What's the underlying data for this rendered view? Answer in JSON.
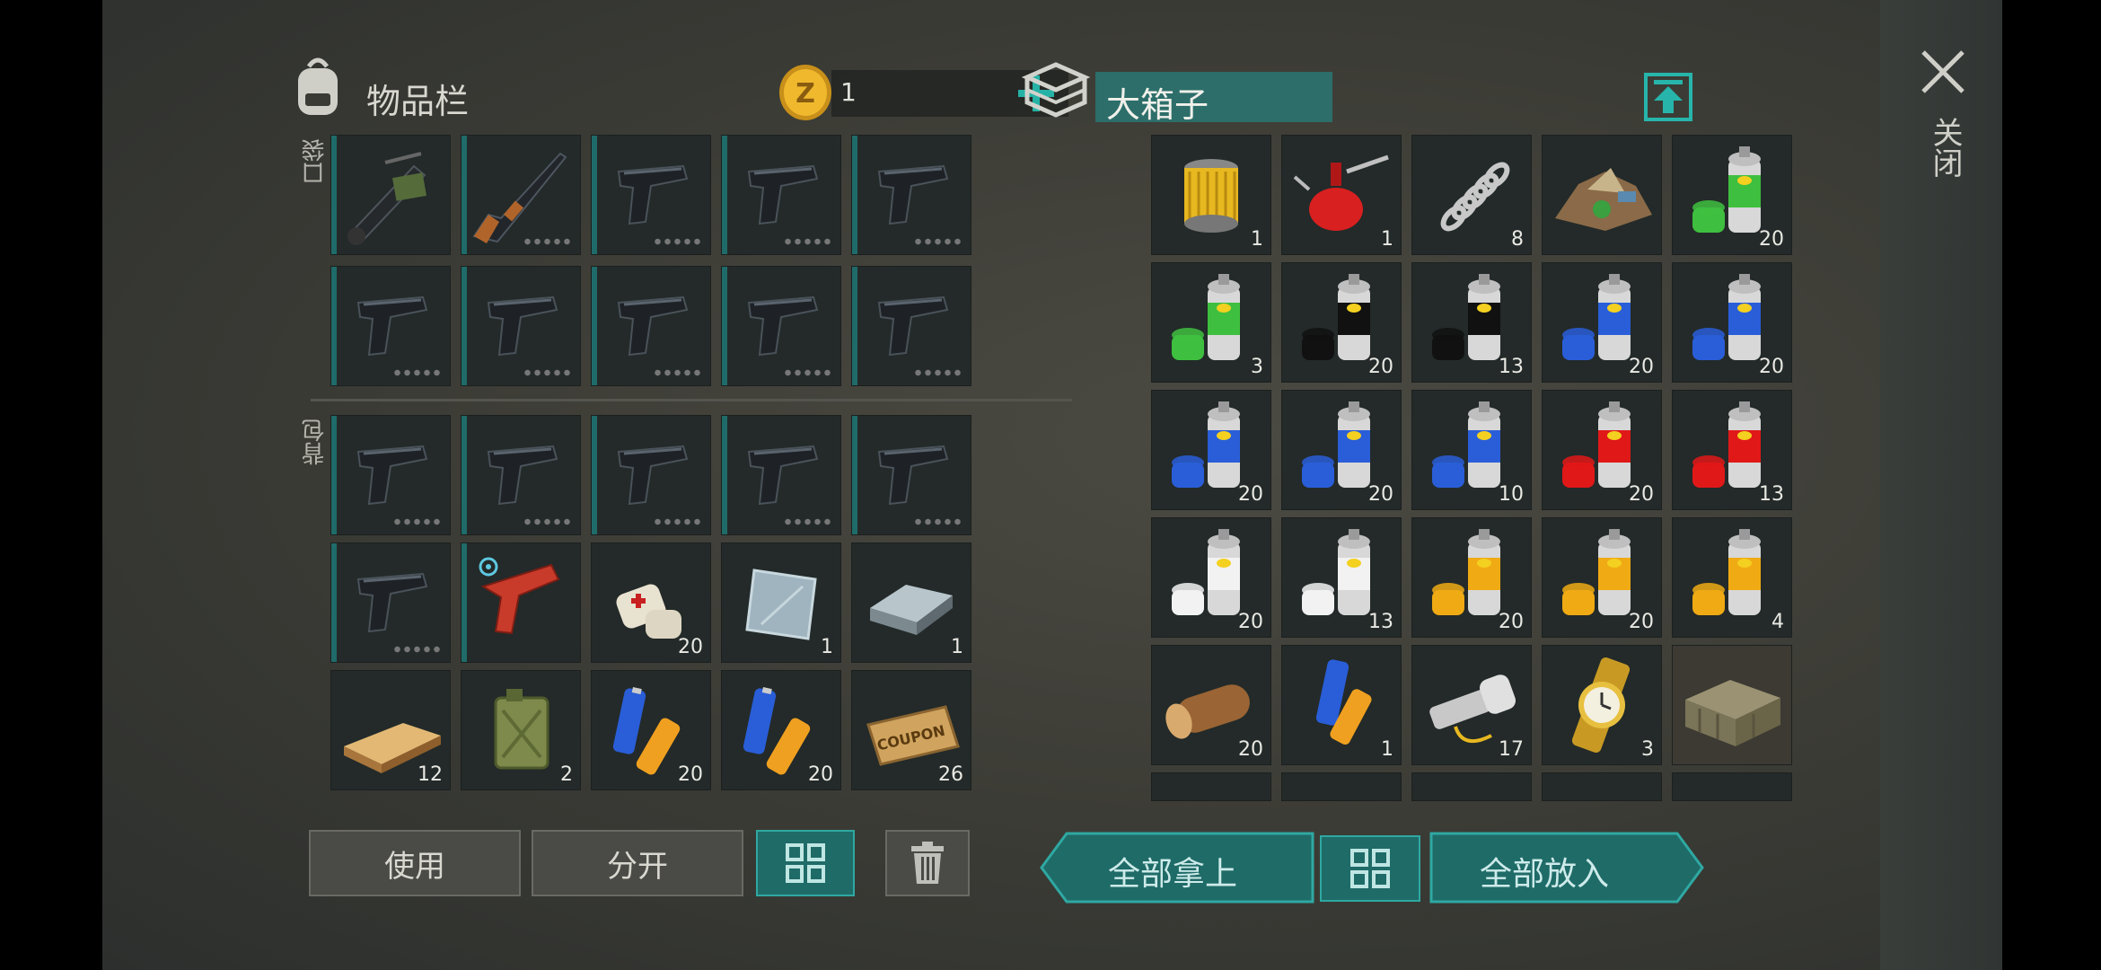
{
  "inventory": {
    "title": "物品栏",
    "currency_value": "1",
    "pocket_label": "口袋",
    "backpack_label": "背包",
    "pocket_items": [
      {
        "icon": "grenade-launcher-icon",
        "count": "",
        "weapon": true
      },
      {
        "icon": "rifle-icon",
        "count": "",
        "weapon": true,
        "dots": true
      },
      {
        "icon": "pistol-icon",
        "count": "",
        "weapon": true,
        "dots": true
      },
      {
        "icon": "pistol-icon",
        "count": "",
        "weapon": true,
        "dots": true
      },
      {
        "icon": "pistol-icon",
        "count": "",
        "weapon": true,
        "dots": true
      },
      {
        "icon": "pistol-icon",
        "count": "",
        "weapon": true,
        "dots": true
      },
      {
        "icon": "pistol-icon",
        "count": "",
        "weapon": true,
        "dots": true
      },
      {
        "icon": "pistol-icon",
        "count": "",
        "weapon": true,
        "dots": true
      },
      {
        "icon": "pistol-icon",
        "count": "",
        "weapon": true,
        "dots": true
      },
      {
        "icon": "pistol-icon",
        "count": "",
        "weapon": true,
        "dots": true
      }
    ],
    "backpack_items": [
      {
        "icon": "pistol-icon",
        "count": "",
        "weapon": true,
        "dots": true
      },
      {
        "icon": "pistol-icon",
        "count": "",
        "weapon": true,
        "dots": true
      },
      {
        "icon": "pistol-icon",
        "count": "",
        "weapon": true,
        "dots": true
      },
      {
        "icon": "pistol-icon",
        "count": "",
        "weapon": true,
        "dots": true
      },
      {
        "icon": "pistol-icon",
        "count": "",
        "weapon": true,
        "dots": true
      },
      {
        "icon": "pistol-icon",
        "count": "",
        "weapon": true,
        "dots": true
      },
      {
        "icon": "flare-gun-icon",
        "count": "",
        "weapon": true
      },
      {
        "icon": "bandage-icon",
        "count": "20"
      },
      {
        "icon": "metal-plate-icon",
        "count": "1"
      },
      {
        "icon": "steel-ingot-icon",
        "count": "1"
      },
      {
        "icon": "wood-plank-icon",
        "count": "12"
      },
      {
        "icon": "jerrycan-icon",
        "count": "2"
      },
      {
        "icon": "batteries-icon",
        "count": "20"
      },
      {
        "icon": "batteries-icon",
        "count": "20"
      },
      {
        "icon": "coupon-icon",
        "count": "26"
      }
    ],
    "buttons": {
      "use": "使用",
      "split": "分开"
    }
  },
  "container": {
    "title": "大箱子",
    "items": [
      {
        "icon": "oil-filter-icon",
        "count": "1"
      },
      {
        "icon": "oil-can-icon",
        "count": "1"
      },
      {
        "icon": "spring-icon",
        "count": "8"
      },
      {
        "icon": "scrap-pile-icon",
        "count": ""
      },
      {
        "icon": "spray-paint-icon",
        "color": "#3fbf3f",
        "count": "20"
      },
      {
        "icon": "spray-paint-icon",
        "color": "#3fbf3f",
        "count": "3"
      },
      {
        "icon": "spray-paint-icon",
        "color": "#111111",
        "count": "20"
      },
      {
        "icon": "spray-paint-icon",
        "color": "#111111",
        "count": "13"
      },
      {
        "icon": "spray-paint-icon",
        "color": "#2a5ed8",
        "count": "20"
      },
      {
        "icon": "spray-paint-icon",
        "color": "#2a5ed8",
        "count": "20"
      },
      {
        "icon": "spray-paint-icon",
        "color": "#2a5ed8",
        "count": "20"
      },
      {
        "icon": "spray-paint-icon",
        "color": "#2a5ed8",
        "count": "20"
      },
      {
        "icon": "spray-paint-icon",
        "color": "#2a5ed8",
        "count": "10"
      },
      {
        "icon": "spray-paint-icon",
        "color": "#e01818",
        "count": "20"
      },
      {
        "icon": "spray-paint-icon",
        "color": "#e01818",
        "count": "13"
      },
      {
        "icon": "spray-paint-icon",
        "color": "#f2f2f2",
        "count": "20"
      },
      {
        "icon": "spray-paint-icon",
        "color": "#f2f2f2",
        "count": "13"
      },
      {
        "icon": "spray-paint-icon",
        "color": "#f0aa14",
        "count": "20"
      },
      {
        "icon": "spray-paint-icon",
        "color": "#f0aa14",
        "count": "20"
      },
      {
        "icon": "spray-paint-icon",
        "color": "#f0aa14",
        "count": "4"
      },
      {
        "icon": "log-icon",
        "count": "20"
      },
      {
        "icon": "battery-icon",
        "count": "1"
      },
      {
        "icon": "flashlight-icon",
        "count": "17"
      },
      {
        "icon": "wristwatch-icon",
        "count": "3"
      },
      {
        "icon": "crate-icon",
        "count": ""
      }
    ],
    "buttons": {
      "take_all": "全部拿上",
      "put_all": "全部放入"
    }
  },
  "close_label": "关闭",
  "colors": {
    "teal": "#1f6b68",
    "teal_border": "#2fa8a2",
    "gold": "#e8b325"
  }
}
